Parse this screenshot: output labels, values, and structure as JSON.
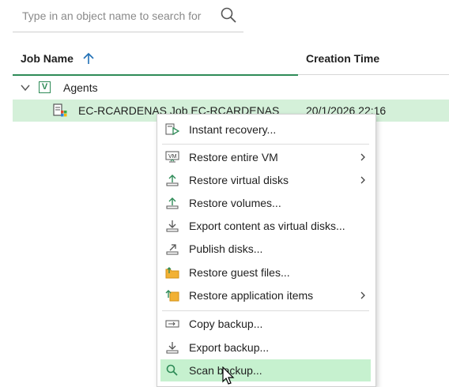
{
  "search": {
    "placeholder": "Type in an object name to search for"
  },
  "columns": {
    "job_name": "Job Name",
    "creation_time": "Creation Time"
  },
  "tree": {
    "group": {
      "label": "Agents",
      "checkbox_glyph": "V"
    },
    "job": {
      "name": "EC-RCARDENAS Job EC-RCARDENAS",
      "creation_time": "20/1/2026 22:16"
    }
  },
  "context_menu": {
    "items": [
      {
        "label": "Instant recovery...",
        "icon": "instant-recovery-icon"
      },
      {
        "label": "Restore entire VM",
        "icon": "vm-restore-icon",
        "submenu": true
      },
      {
        "label": "Restore virtual disks",
        "icon": "restore-disks-icon",
        "submenu": true
      },
      {
        "label": "Restore volumes...",
        "icon": "restore-volumes-icon"
      },
      {
        "label": "Export content as virtual disks...",
        "icon": "export-disks-icon"
      },
      {
        "label": "Publish disks...",
        "icon": "publish-disks-icon"
      },
      {
        "label": "Restore guest files...",
        "icon": "folder-icon"
      },
      {
        "label": "Restore application items",
        "icon": "app-items-icon",
        "submenu": true
      },
      {
        "label": "Copy backup...",
        "icon": "copy-backup-icon"
      },
      {
        "label": "Export backup...",
        "icon": "export-backup-icon"
      },
      {
        "label": "Scan backup...",
        "icon": "magnifier-icon",
        "highlighted": true
      }
    ]
  },
  "colors": {
    "accent": "#2e8b57",
    "selection": "#d4f0d9",
    "menu_highlight": "#c6f1cf"
  }
}
